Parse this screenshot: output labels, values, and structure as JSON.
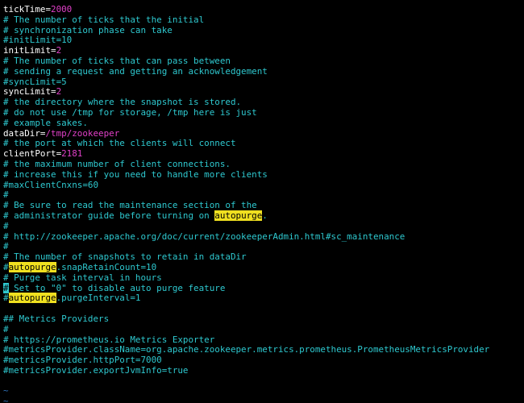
{
  "editor": {
    "colors": {
      "background": "#000000",
      "comment": "#2ec8cf",
      "key": "#ffffff",
      "value": "#e040c8",
      "search_highlight": "#f0e020",
      "empty_line_marker": "#2e6fb4"
    },
    "lines": [
      [
        {
          "t": "tickTime=",
          "s": "key"
        },
        {
          "t": "2000",
          "s": "value"
        }
      ],
      [
        {
          "t": "# The number of ticks that the initial",
          "s": "comment"
        }
      ],
      [
        {
          "t": "# synchronization phase can take",
          "s": "comment"
        }
      ],
      [
        {
          "t": "#initLimit=10",
          "s": "comment"
        }
      ],
      [
        {
          "t": "initLimit=",
          "s": "key"
        },
        {
          "t": "2",
          "s": "value"
        }
      ],
      [
        {
          "t": "# The number of ticks that can pass between",
          "s": "comment"
        }
      ],
      [
        {
          "t": "# sending a request and getting an acknowledgement",
          "s": "comment"
        }
      ],
      [
        {
          "t": "#syncLimit=5",
          "s": "comment"
        }
      ],
      [
        {
          "t": "syncLimit=",
          "s": "key"
        },
        {
          "t": "2",
          "s": "value"
        }
      ],
      [
        {
          "t": "# the directory where the snapshot is stored.",
          "s": "comment"
        }
      ],
      [
        {
          "t": "# do not use /tmp for storage, /tmp here is just",
          "s": "comment"
        }
      ],
      [
        {
          "t": "# example sakes.",
          "s": "comment"
        }
      ],
      [
        {
          "t": "dataDir=",
          "s": "key"
        },
        {
          "t": "/tmp/zookeeper",
          "s": "value"
        }
      ],
      [
        {
          "t": "# the port at which the clients will connect",
          "s": "comment"
        }
      ],
      [
        {
          "t": "clientPort=",
          "s": "key"
        },
        {
          "t": "2181",
          "s": "value"
        }
      ],
      [
        {
          "t": "# the maximum number of client connections.",
          "s": "comment"
        }
      ],
      [
        {
          "t": "# increase this if you need to handle more clients",
          "s": "comment"
        }
      ],
      [
        {
          "t": "#maxClientCnxns=60",
          "s": "comment"
        }
      ],
      [
        {
          "t": "#",
          "s": "comment"
        }
      ],
      [
        {
          "t": "# Be sure to read the maintenance section of the",
          "s": "comment"
        }
      ],
      [
        {
          "t": "# administrator guide before turning on ",
          "s": "comment"
        },
        {
          "t": "autopurge",
          "s": "hl"
        },
        {
          "t": ".",
          "s": "comment"
        }
      ],
      [
        {
          "t": "#",
          "s": "comment"
        }
      ],
      [
        {
          "t": "# http://zookeeper.apache.org/doc/current/zookeeperAdmin.html#sc_maintenance",
          "s": "comment"
        }
      ],
      [
        {
          "t": "#",
          "s": "comment"
        }
      ],
      [
        {
          "t": "# The number of snapshots to retain in dataDir",
          "s": "comment"
        }
      ],
      [
        {
          "t": "#",
          "s": "comment"
        },
        {
          "t": "autopurge",
          "s": "hl"
        },
        {
          "t": ".snapRetainCount=10",
          "s": "comment"
        }
      ],
      [
        {
          "t": "# Purge task interval in hours",
          "s": "comment"
        }
      ],
      [
        {
          "t": "#",
          "s": "cursor"
        },
        {
          "t": " Set to \"0\" to disable auto purge feature",
          "s": "comment"
        }
      ],
      [
        {
          "t": "#",
          "s": "comment"
        },
        {
          "t": "autopurge",
          "s": "hl"
        },
        {
          "t": ".purgeInterval=1",
          "s": "comment"
        }
      ],
      [],
      [
        {
          "t": "## Metrics Providers",
          "s": "comment"
        }
      ],
      [
        {
          "t": "#",
          "s": "comment"
        }
      ],
      [
        {
          "t": "# https://prometheus.io Metrics Exporter",
          "s": "comment"
        }
      ],
      [
        {
          "t": "#metricsProvider.className=org.apache.zookeeper.metrics.prometheus.PrometheusMetricsProvider",
          "s": "comment"
        }
      ],
      [
        {
          "t": "#metricsProvider.httpPort=7000",
          "s": "comment"
        }
      ],
      [
        {
          "t": "#metricsProvider.exportJvmInfo=true",
          "s": "comment"
        }
      ],
      [],
      [
        {
          "t": "~",
          "s": "tilde"
        }
      ],
      [
        {
          "t": "~",
          "s": "tilde"
        }
      ]
    ]
  }
}
